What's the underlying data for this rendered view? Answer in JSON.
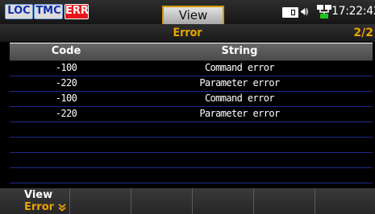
{
  "status": {
    "indicators": [
      "LOC",
      "TMC",
      "ERR"
    ],
    "active_tab": "View",
    "time": "17:22:42",
    "icons": [
      "battery-icon",
      "speaker-icon",
      "network-icon"
    ]
  },
  "page": {
    "title": "Error",
    "page_indicator": "2/2"
  },
  "table": {
    "headers": {
      "code": "Code",
      "string": "String"
    },
    "rows": [
      {
        "code": "-100",
        "string": "Command error"
      },
      {
        "code": "-220",
        "string": "Parameter error"
      },
      {
        "code": "-100",
        "string": "Command error"
      },
      {
        "code": "-220",
        "string": "Parameter error"
      },
      {
        "code": "",
        "string": ""
      },
      {
        "code": "",
        "string": ""
      },
      {
        "code": "",
        "string": ""
      },
      {
        "code": "",
        "string": ""
      }
    ]
  },
  "softkeys": [
    {
      "label": "View",
      "value": "Error"
    },
    {
      "label": "",
      "value": ""
    },
    {
      "label": "",
      "value": ""
    },
    {
      "label": "",
      "value": ""
    },
    {
      "label": "",
      "value": ""
    },
    {
      "label": "",
      "value": ""
    }
  ],
  "colors": {
    "accent": "#e8a400",
    "err_indicator": "#e8161a",
    "row_divider": "#1b2a8c"
  }
}
